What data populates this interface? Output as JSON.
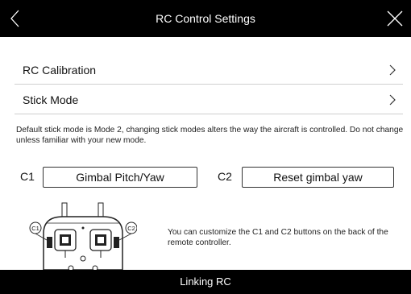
{
  "header": {
    "title": "RC Control Settings"
  },
  "rows": [
    {
      "label": "RC Calibration"
    },
    {
      "label": "Stick Mode"
    }
  ],
  "stick_mode_note": "Default stick mode is Mode 2, changing stick modes alters the way the aircraft is controlled. Do not change unless familiar with your new mode.",
  "custom_buttons": {
    "c1": {
      "label": "C1",
      "value": "Gimbal Pitch/Yaw"
    },
    "c2": {
      "label": "C2",
      "value": "Reset gimbal yaw"
    }
  },
  "illustration": {
    "c1_tag": "C1",
    "c2_tag": "C2"
  },
  "customize_note": "You can customize the C1 and C2 buttons on the back of the remote controller.",
  "footer": {
    "label": "Linking RC"
  }
}
